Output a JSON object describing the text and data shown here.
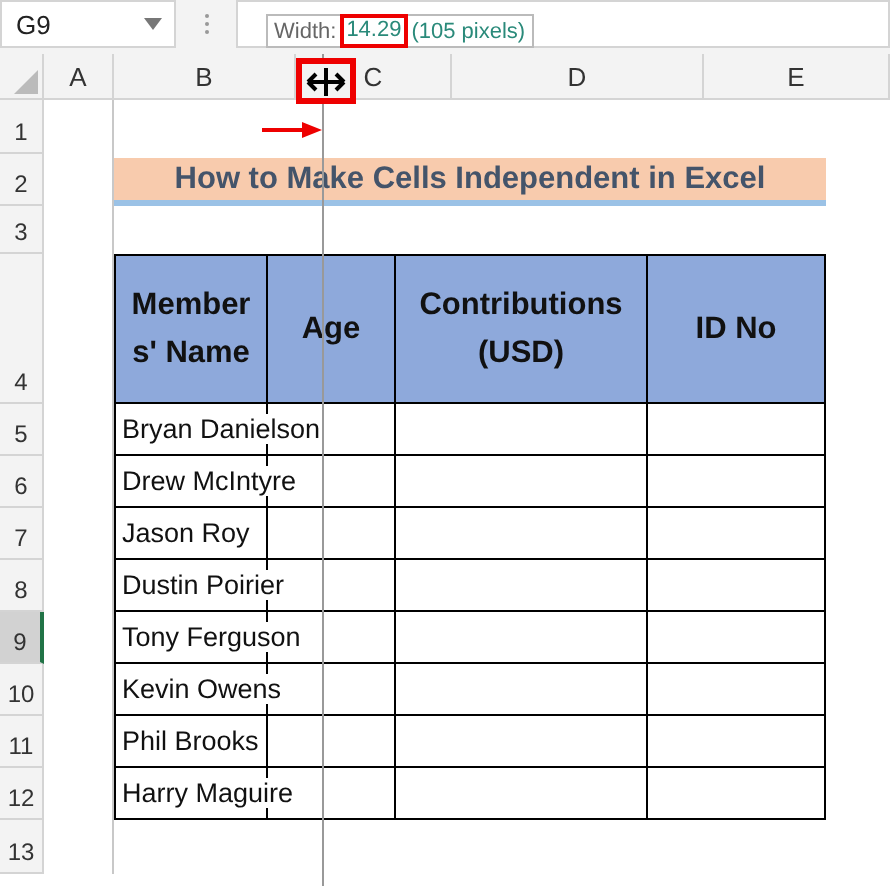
{
  "formula_bar": {
    "name_box": "G9"
  },
  "tooltip": {
    "label": "Width:",
    "value": "14.29",
    "detail": "(105 pixels)"
  },
  "column_headers": [
    "A",
    "B",
    "C",
    "D",
    "E"
  ],
  "row_headers": [
    {
      "label": "1",
      "selected": false
    },
    {
      "label": "2",
      "selected": false
    },
    {
      "label": "3",
      "selected": false
    },
    {
      "label": "4",
      "selected": false
    },
    {
      "label": "5",
      "selected": false
    },
    {
      "label": "6",
      "selected": false
    },
    {
      "label": "7",
      "selected": false
    },
    {
      "label": "8",
      "selected": false
    },
    {
      "label": "9",
      "selected": true
    },
    {
      "label": "10",
      "selected": false
    },
    {
      "label": "11",
      "selected": false
    },
    {
      "label": "12",
      "selected": false
    },
    {
      "label": "13",
      "selected": false
    }
  ],
  "title": "How to Make Cells Independent in Excel",
  "table": {
    "columns": [
      "Members' Name",
      "Age",
      "Contributions (USD)",
      "ID No"
    ],
    "rows": [
      "Bryan Danielson",
      "Drew McIntyre",
      "Jason Roy",
      "Dustin Poirier",
      "Tony Ferguson",
      "Kevin Owens",
      "Phil Brooks",
      "Harry Maguire"
    ]
  }
}
